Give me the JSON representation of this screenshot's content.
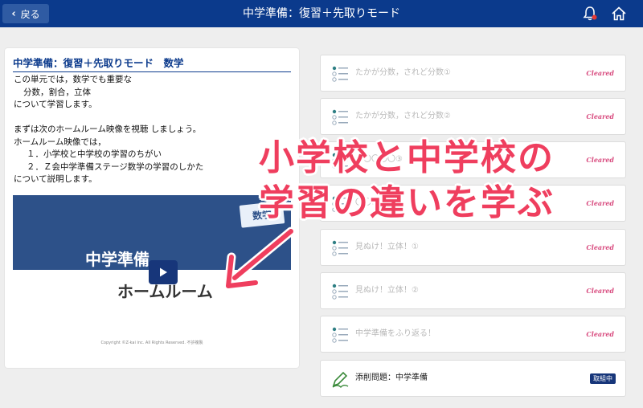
{
  "header": {
    "back_label": "戻る",
    "title": "中学準備：復習＋先取りモード",
    "icons": [
      "bell-icon",
      "home-icon"
    ]
  },
  "panel": {
    "title": "中学準備：復習＋先取りモード　数学",
    "lines": [
      "この単元では，数学でも重要な",
      "分数，割合，立体",
      "について学習します。",
      "",
      "まずは次のホームルーム映像を視聴 しましょう。",
      "ホームルーム映像では，",
      "１．小学校と中学校の学習のちがい",
      "２．Ｚ会中学準備ステージ数学の学習のしかた",
      "について説明します。"
    ],
    "video": {
      "tab_label": "数学",
      "title_line1": "中学準備",
      "title_line2": "ホームルーム",
      "copyright": "Copyright ©Z-kai inc. All Rights Reserved. 不許複製"
    }
  },
  "lessons": [
    {
      "title": "たかが分数，されど分数①",
      "status": "Cleared"
    },
    {
      "title": "たかが分数，されど分数②",
      "status": "Cleared"
    },
    {
      "title": "合〇〇〇〇③",
      "status": "Cleared"
    },
    {
      "title": "〇〇〇〇ど",
      "status": "Cleared"
    },
    {
      "title": "見ぬけ！立体！①",
      "status": "Cleared"
    },
    {
      "title": "見ぬけ！立体！②",
      "status": "Cleared"
    },
    {
      "title": "中学準備をふり返る！",
      "status": "Cleared"
    },
    {
      "title": "添削問題：中学準備",
      "badge": "取組中"
    }
  ],
  "overlay": {
    "line1": "小学校と中学校の",
    "line2": "学習の違いを学ぶ"
  },
  "colors": {
    "header": "#0b3a8c",
    "accent_pink": "#ef3e5e",
    "cleared": "#d84a7e",
    "badge": "#17367a"
  }
}
